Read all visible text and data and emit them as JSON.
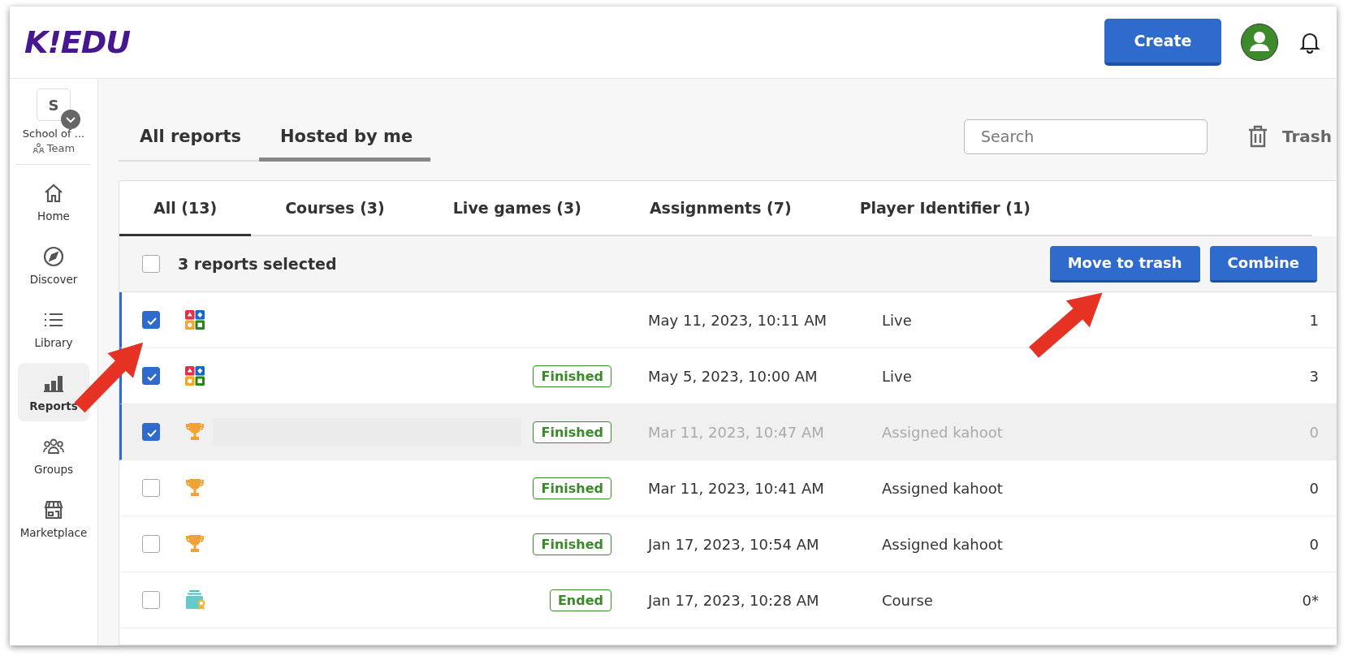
{
  "header": {
    "logo": "K!EDU",
    "create_button": "Create"
  },
  "sidebar": {
    "org": {
      "initial": "S",
      "name": "School of ...",
      "team": "Team"
    },
    "items": [
      {
        "kind": "home",
        "label": "Home",
        "selected": false
      },
      {
        "kind": "discover",
        "label": "Discover",
        "selected": false
      },
      {
        "kind": "library",
        "label": "Library",
        "selected": false
      },
      {
        "kind": "reports",
        "label": "Reports",
        "selected": true
      },
      {
        "kind": "groups",
        "label": "Groups",
        "selected": false
      },
      {
        "kind": "marketplace",
        "label": "Marketplace",
        "selected": false
      }
    ]
  },
  "top_tabs": [
    {
      "label": "All reports",
      "selected": false
    },
    {
      "label": "Hosted by me",
      "selected": true
    }
  ],
  "search": {
    "placeholder": "Search"
  },
  "trash_link": "Trash",
  "filter_tabs": [
    {
      "label": "All (13)",
      "selected": true
    },
    {
      "label": "Courses (3)",
      "selected": false
    },
    {
      "label": "Live games (3)",
      "selected": false
    },
    {
      "label": "Assignments (7)",
      "selected": false
    },
    {
      "label": "Player Identifier (1)",
      "selected": false
    }
  ],
  "toolbar": {
    "select_all_checked": false,
    "selection_text": "3 reports selected",
    "buttons": [
      "Move to trash",
      "Combine"
    ]
  },
  "rows": [
    {
      "kind": "quiz",
      "checked": true,
      "dimmed": false,
      "title_hidden": false,
      "date": "May 11, 2023, 10:11 AM",
      "type": "Live",
      "count": "1"
    },
    {
      "kind": "quiz",
      "checked": true,
      "dimmed": false,
      "title_hidden": false,
      "status": "Finished",
      "date": "May 5, 2023, 10:00 AM",
      "type": "Live",
      "count": "3"
    },
    {
      "kind": "assignment",
      "checked": true,
      "dimmed": true,
      "title_hidden": true,
      "status": "Finished",
      "date": "Mar 11, 2023, 10:47 AM",
      "type": "Assigned kahoot",
      "count": "0"
    },
    {
      "kind": "assignment",
      "checked": false,
      "dimmed": false,
      "title_hidden": false,
      "status": "Finished",
      "date": "Mar 11, 2023, 10:41 AM",
      "type": "Assigned kahoot",
      "count": "0"
    },
    {
      "kind": "assignment",
      "checked": false,
      "dimmed": false,
      "title_hidden": false,
      "status": "Finished",
      "date": "Jan 17, 2023, 10:54 AM",
      "type": "Assigned kahoot",
      "count": "0"
    },
    {
      "kind": "course",
      "checked": false,
      "dimmed": false,
      "title_hidden": false,
      "status": "Ended",
      "date": "Jan 17, 2023, 10:28 AM",
      "type": "Course",
      "count": "0*"
    }
  ]
}
